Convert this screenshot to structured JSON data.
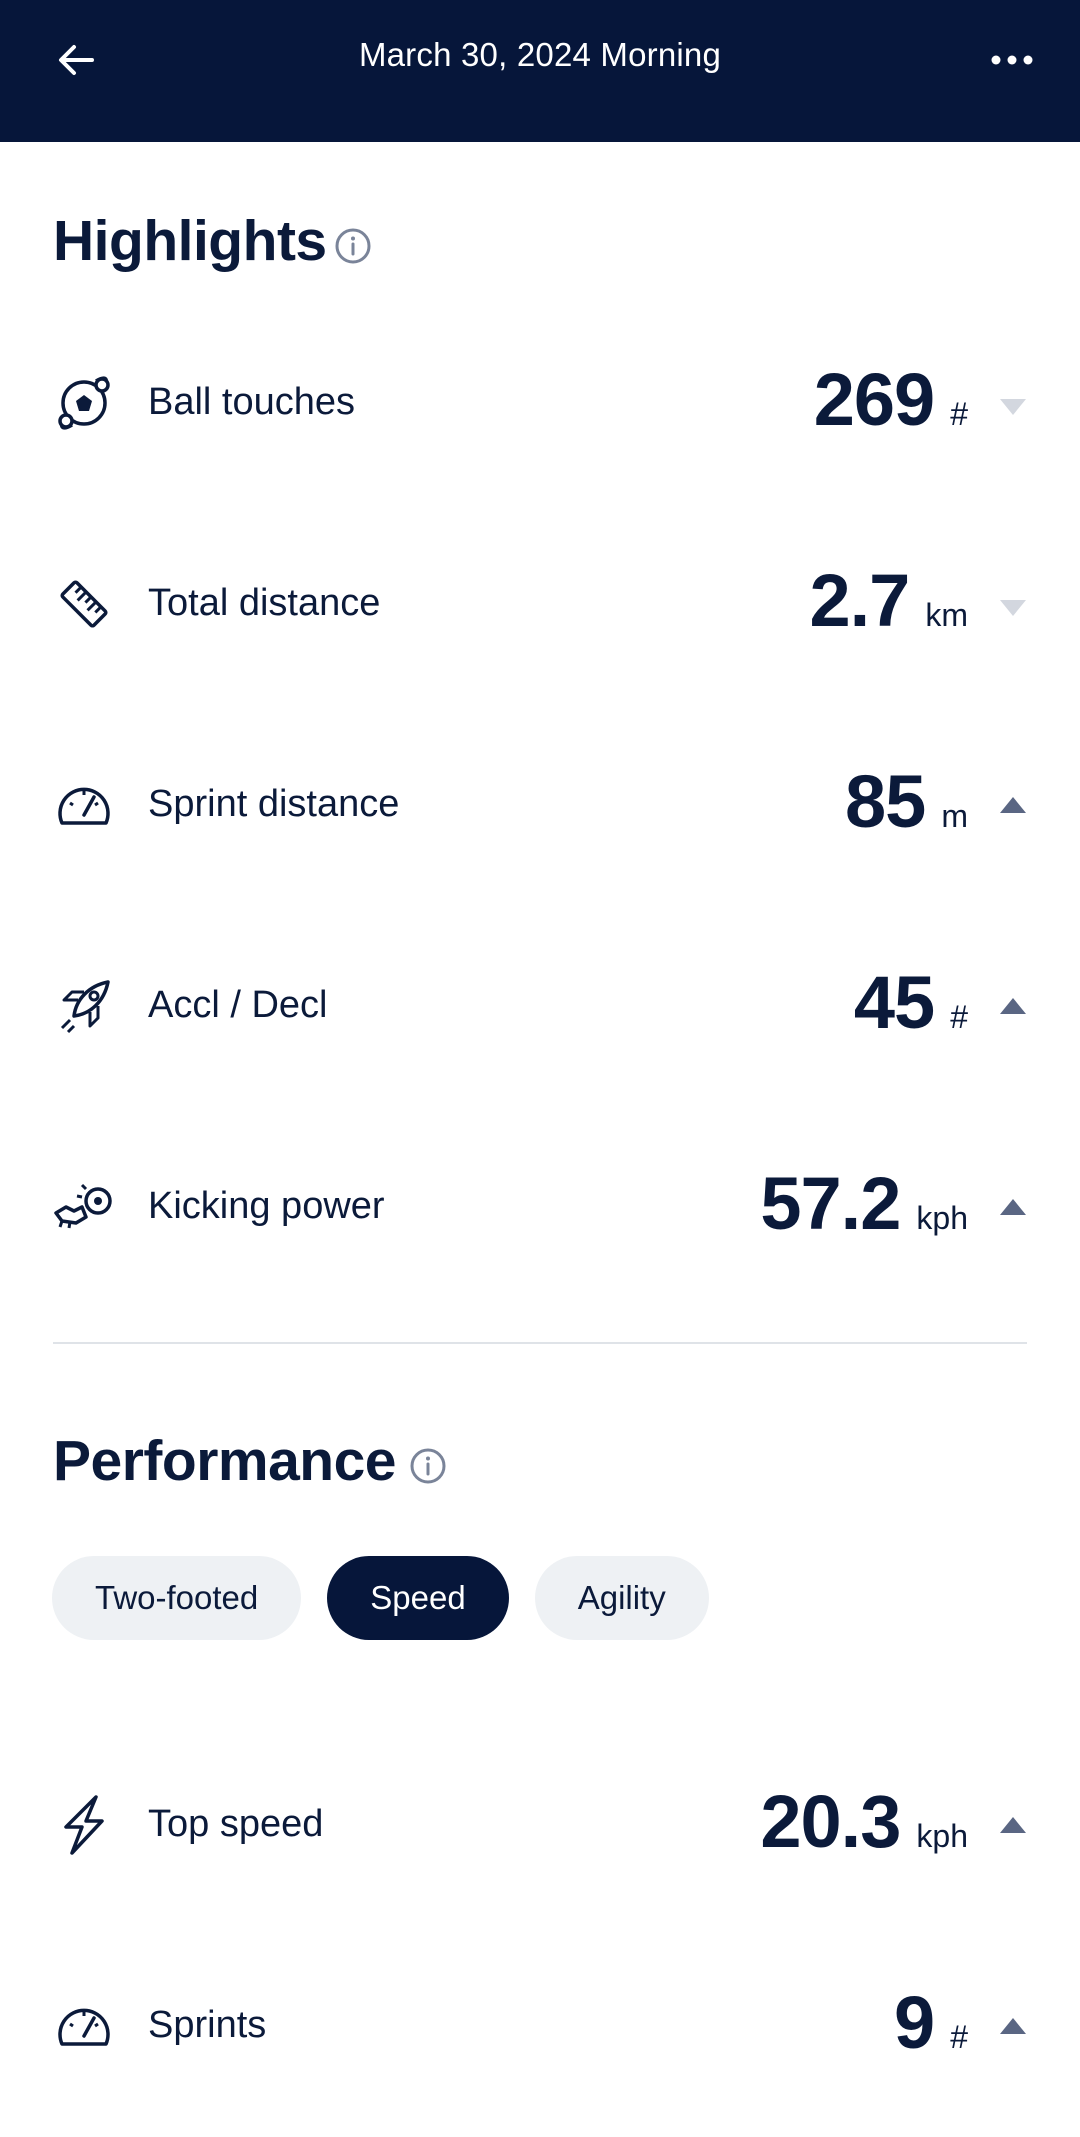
{
  "header": {
    "title": "March 30, 2024 Morning"
  },
  "highlights": {
    "title": "Highlights",
    "metrics": [
      {
        "label": "Ball touches",
        "value": "269",
        "unit": "#",
        "trend": "down",
        "icon": "ball-icon"
      },
      {
        "label": "Total distance",
        "value": "2.7",
        "unit": "km",
        "trend": "down",
        "icon": "ruler-icon"
      },
      {
        "label": "Sprint distance",
        "value": "85",
        "unit": "m",
        "trend": "up",
        "icon": "speedometer-icon"
      },
      {
        "label": "Accl / Decl",
        "value": "45",
        "unit": "#",
        "trend": "up",
        "icon": "rocket-icon"
      },
      {
        "label": "Kicking power",
        "value": "57.2",
        "unit": "kph",
        "trend": "up",
        "icon": "kick-icon"
      }
    ]
  },
  "performance": {
    "title": "Performance",
    "tabs": [
      {
        "label": "Two-footed",
        "active": false
      },
      {
        "label": "Speed",
        "active": true
      },
      {
        "label": "Agility",
        "active": false
      }
    ],
    "metrics": [
      {
        "label": "Top speed",
        "value": "20.3",
        "unit": "kph",
        "trend": "up",
        "icon": "lightning-icon"
      },
      {
        "label": "Sprints",
        "value": "9",
        "unit": "#",
        "trend": "up",
        "icon": "speedometer-icon"
      }
    ]
  },
  "colors": {
    "header_bg": "#06163a",
    "text": "#0b1a3a",
    "trend_up": "#5a6683",
    "trend_down": "#d3d7df",
    "chip_bg": "#eef1f4"
  }
}
